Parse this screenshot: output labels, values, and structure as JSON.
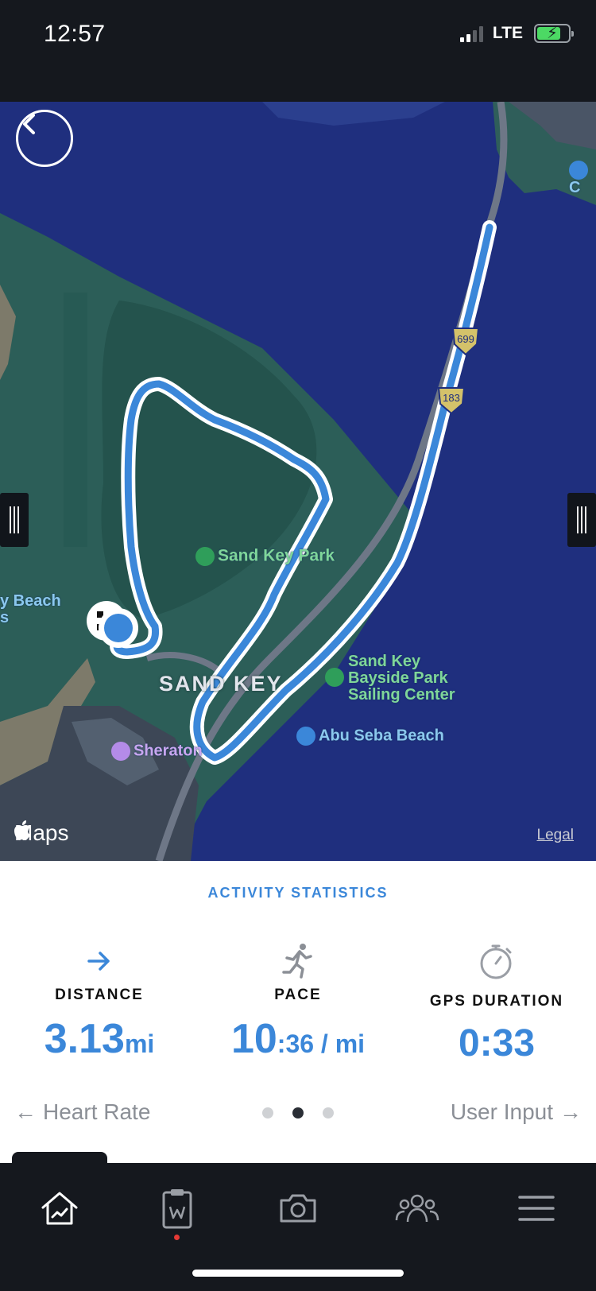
{
  "status_bar": {
    "time": "12:57",
    "network": "LTE",
    "battery_level": 0.75,
    "colors": {
      "battery": "#4cd964"
    }
  },
  "map": {
    "labels": {
      "park": "Sand Key Park",
      "bayside": [
        "Sand Key",
        "Bayside Park",
        "Sailing Center"
      ],
      "area": "SAND KEY",
      "beach_left": [
        "y Beach",
        "s"
      ],
      "abu_seba": "Abu Seba Beach",
      "sheraton": "Sheraton",
      "road_shield_1": "699",
      "road_shield_2": "183",
      "corner": "C"
    },
    "attribution": "Maps",
    "legal": "Legal",
    "colors": {
      "water": "#1f2f7e",
      "land": "#2c5e58",
      "route": "#3b87d9"
    }
  },
  "stats": {
    "title": "ACTIVITY STATISTICS",
    "distance": {
      "label": "DISTANCE",
      "value": "3.13",
      "unit": "mi"
    },
    "pace": {
      "label": "PACE",
      "value": "10",
      "unit": ":36 / mi"
    },
    "gps_duration": {
      "label": "GPS DURATION",
      "value": "0:33"
    },
    "nav_prev": "Heart Rate",
    "nav_next": "User Input",
    "page_index": 1,
    "page_count": 3,
    "colors": {
      "accent": "#3b87d9"
    }
  },
  "tab_bar": {
    "items": [
      "home-icon",
      "clipboard-icon",
      "camera-icon",
      "community-icon",
      "menu-icon"
    ],
    "active": "home-icon"
  }
}
